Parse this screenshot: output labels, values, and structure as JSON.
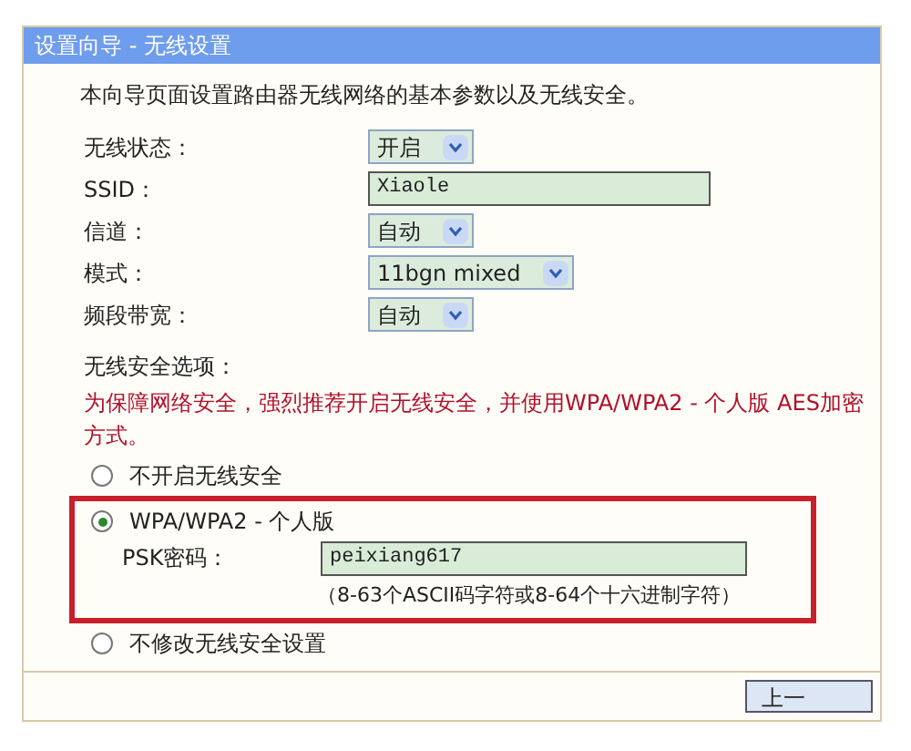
{
  "wizard": {
    "title": "设置向导 - 无线设置",
    "intro": "本向导页面设置路由器无线网络的基本参数以及无线安全。",
    "fields": [
      {
        "kind": "select",
        "label": "无线状态：",
        "value": "开启"
      },
      {
        "kind": "text",
        "label": "SSID：",
        "value": "Xiaole"
      },
      {
        "kind": "select",
        "label": "信道：",
        "value": "自动"
      },
      {
        "kind": "select",
        "label": "模式：",
        "value": "11bgn mixed"
      },
      {
        "kind": "select",
        "label": "频段带宽：",
        "value": "自动"
      }
    ],
    "security": {
      "heading": "无线安全选项：",
      "warning": "为保障网络安全，强烈推荐开启无线安全，并使用WPA/WPA2 - 个人版 AES加密方式。",
      "options": [
        {
          "label": "不开启无线安全",
          "selected": false,
          "highlighted": false
        },
        {
          "label": "WPA/WPA2 - 个人版",
          "selected": true,
          "highlighted": true,
          "psk_label": "PSK密码：",
          "psk_value": "peixiang617",
          "psk_hint": "（8-63个ASCII码字符或8-64个十六进制字符）"
        },
        {
          "label": "不修改无线安全设置",
          "selected": false,
          "highlighted": false
        }
      ]
    },
    "buttons": [
      {
        "label": "上一"
      }
    ]
  }
}
